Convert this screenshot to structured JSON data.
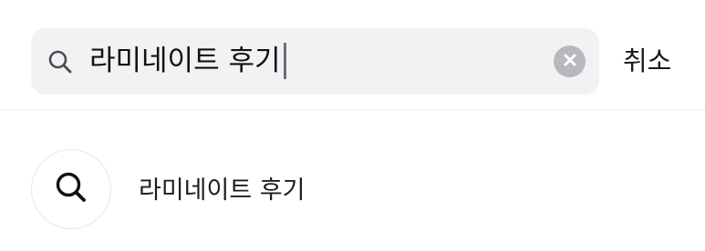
{
  "search": {
    "query": "라미네이트 후기",
    "search_icon": "search-icon",
    "clear_icon": "close-circle-icon",
    "cancel_label": "취소"
  },
  "suggestions": [
    {
      "icon": "search-icon",
      "label": "라미네이트 후기"
    }
  ],
  "colors": {
    "search_box_bg": "#f1f2f4",
    "clear_button_bg": "#b8b9bd",
    "text": "#111111",
    "divider": "#eeeeef"
  }
}
